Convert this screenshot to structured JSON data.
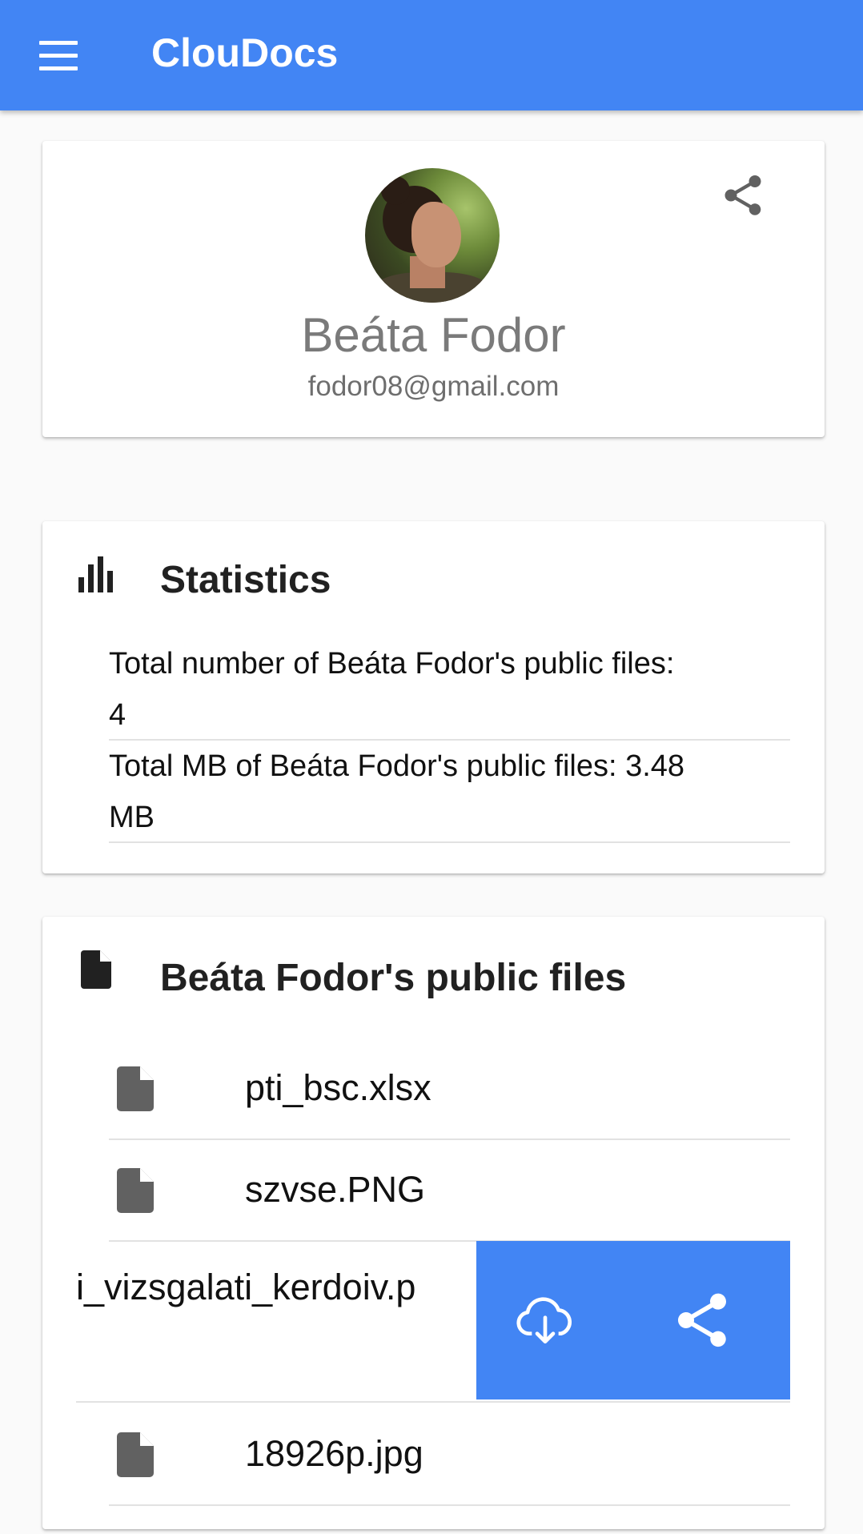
{
  "app": {
    "title": "ClouDocs",
    "accent_color": "#4285f4",
    "menu_icon": "menu-icon"
  },
  "profile": {
    "name": "Beáta Fodor",
    "email": "fodor08@gmail.com",
    "share_icon": "share-icon"
  },
  "statistics": {
    "title": "Statistics",
    "icon": "bar-chart-icon",
    "rows": [
      {
        "line1": "Total number of Beáta Fodor's public files:",
        "line2": "4"
      },
      {
        "line1": "Total MB of Beáta Fodor's public files: 3.48",
        "line2": "MB"
      }
    ]
  },
  "files": {
    "title": "Beáta Fodor's public files",
    "icon": "file-icon",
    "items": [
      {
        "name": "pti_bsc.xlsx"
      },
      {
        "name": "szvse.PNG"
      },
      {
        "name": "i_vizsgalati_kerdoiv.p",
        "swiped": true
      },
      {
        "name": "18926p.jpg"
      }
    ],
    "swipe_actions": [
      "download-cloud-icon",
      "share-icon"
    ]
  }
}
